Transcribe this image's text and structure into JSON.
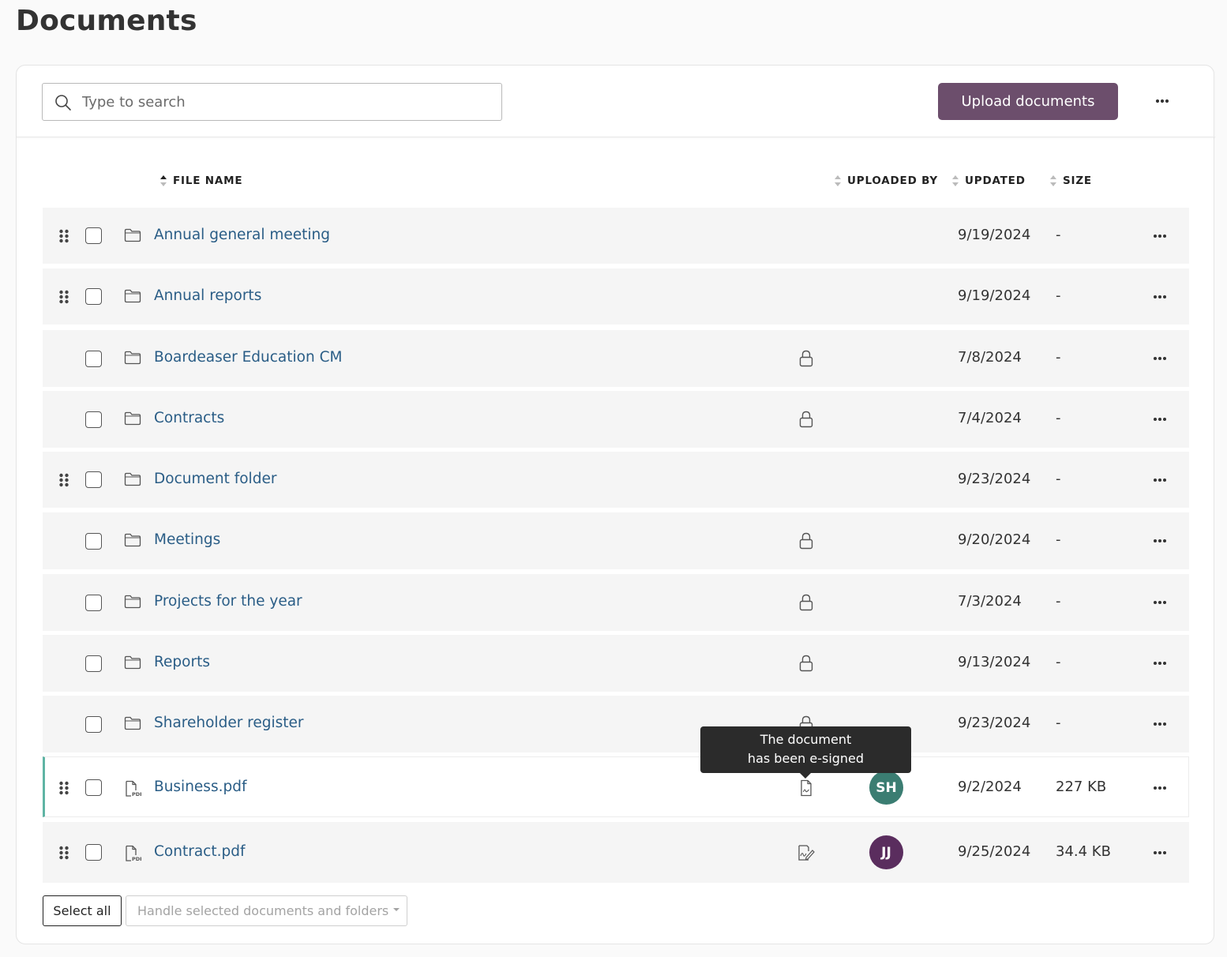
{
  "page": {
    "title": "Documents"
  },
  "toolbar": {
    "search_placeholder": "Type to search",
    "search_value": "",
    "upload_label": "Upload documents",
    "more_icon": "more-horizontal-icon"
  },
  "columns": {
    "file_name": "FILE NAME",
    "uploaded_by": "UPLOADED BY",
    "updated": "UPDATED",
    "size": "SIZE"
  },
  "rows": [
    {
      "type": "folder",
      "name": "Annual general meeting",
      "draggable": true,
      "status": "",
      "uploader": "",
      "updated": "9/19/2024",
      "size": "-"
    },
    {
      "type": "folder",
      "name": "Annual reports",
      "draggable": true,
      "status": "",
      "uploader": "",
      "updated": "9/19/2024",
      "size": "-"
    },
    {
      "type": "folder",
      "name": "Boardeaser Education CM",
      "draggable": false,
      "status": "lock",
      "uploader": "",
      "updated": "7/8/2024",
      "size": "-"
    },
    {
      "type": "folder",
      "name": "Contracts",
      "draggable": false,
      "status": "lock",
      "uploader": "",
      "updated": "7/4/2024",
      "size": "-"
    },
    {
      "type": "folder",
      "name": "Document folder",
      "draggable": true,
      "status": "",
      "uploader": "",
      "updated": "9/23/2024",
      "size": "-"
    },
    {
      "type": "folder",
      "name": "Meetings",
      "draggable": false,
      "status": "lock",
      "uploader": "",
      "updated": "9/20/2024",
      "size": "-"
    },
    {
      "type": "folder",
      "name": "Projects for the year",
      "draggable": false,
      "status": "lock",
      "uploader": "",
      "updated": "7/3/2024",
      "size": "-"
    },
    {
      "type": "folder",
      "name": "Reports",
      "draggable": false,
      "status": "lock",
      "uploader": "",
      "updated": "9/13/2024",
      "size": "-"
    },
    {
      "type": "folder",
      "name": "Shareholder register",
      "draggable": false,
      "status": "lock",
      "uploader": "",
      "updated": "9/23/2024",
      "size": "-"
    },
    {
      "type": "pdf",
      "name": "Business.pdf",
      "draggable": true,
      "status": "esigned",
      "uploader": "SH",
      "uploader_color": "#3b7d72",
      "updated": "9/2/2024",
      "size": "227 KB",
      "active": true
    },
    {
      "type": "pdf",
      "name": "Contract.pdf",
      "draggable": true,
      "status": "signature",
      "uploader": "JJ",
      "uploader_color": "#5a2d5e",
      "updated": "9/25/2024",
      "size": "34.4 KB"
    }
  ],
  "tooltip": {
    "line1": "The document",
    "line2": "has been e-signed"
  },
  "footer": {
    "select_all": "Select all",
    "handle_selected": "Handle selected documents and folders"
  },
  "colors": {
    "primary": "#6c4e6c",
    "link": "#2a5d86",
    "active_accent": "#5fb4a4"
  }
}
